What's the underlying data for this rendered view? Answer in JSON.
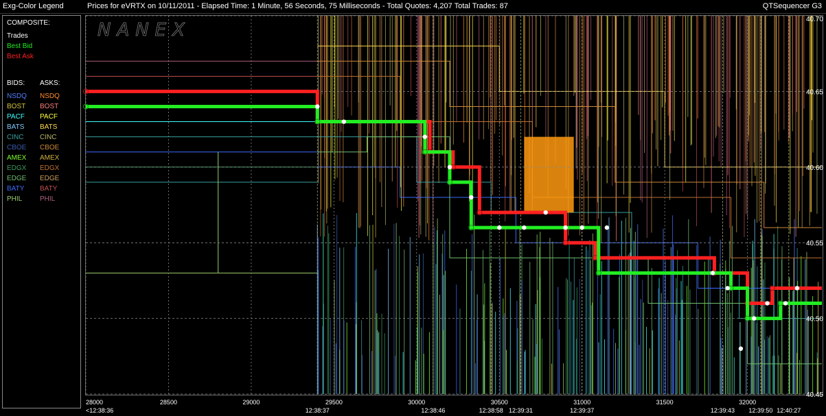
{
  "window": {
    "legend_title": "Exg-Color Legend",
    "chart_title": "Prices for  eVRTX  on  10/11/2011  -  Elapsed Time: 1 Minute, 56 Seconds, 75 Milliseconds  -  Total Quotes: 4,207  Total Trades: 87",
    "app_name": "QTSequencer G3"
  },
  "watermark": "NANEX",
  "legend": {
    "composite_header": "COMPOSITE:",
    "composite": [
      {
        "label": "Trades",
        "color": "#ffffff"
      },
      {
        "label": "Best Bid",
        "color": "#22ee22"
      },
      {
        "label": "Best Ask",
        "color": "#ff2020"
      }
    ],
    "bids_header": "BIDS:",
    "asks_header": "ASKS:",
    "exchanges": [
      {
        "bid": "NSDQ",
        "ask": "NSDQ",
        "bid_color": "#4f7fff",
        "ask_color": "#ff8c30"
      },
      {
        "bid": "BOST",
        "ask": "BOST",
        "bid_color": "#d6c63c",
        "ask_color": "#ff7f7f"
      },
      {
        "bid": "PACF",
        "ask": "PACF",
        "bid_color": "#40ffff",
        "ask_color": "#ffff40"
      },
      {
        "bid": "BATS",
        "ask": "BATS",
        "bid_color": "#7fc8ff",
        "ask_color": "#ffd850"
      },
      {
        "bid": "CINC",
        "ask": "CINC",
        "bid_color": "#3aa0a0",
        "ask_color": "#b7b76a"
      },
      {
        "bid": "CBOE",
        "ask": "CBOE",
        "bid_color": "#3c5cb0",
        "ask_color": "#d08a3a"
      },
      {
        "bid": "AMEX",
        "ask": "AMEX",
        "bid_color": "#7fff30",
        "ask_color": "#d0b040"
      },
      {
        "bid": "EDGX",
        "ask": "EDGX",
        "bid_color": "#3c9c5c",
        "ask_color": "#c07030"
      },
      {
        "bid": "EDGE",
        "ask": "EDGE",
        "bid_color": "#6fbf6f",
        "ask_color": "#d0a060"
      },
      {
        "bid": "BATY",
        "ask": "BATY",
        "bid_color": "#3c6cff",
        "ask_color": "#c05050"
      },
      {
        "bid": "PHIL",
        "ask": "PHIL",
        "bid_color": "#9ccf6c",
        "ask_color": "#b06080"
      }
    ]
  },
  "chart_data": {
    "type": "line",
    "xlabel": "",
    "ylabel": "",
    "xlim": [
      28000,
      32450
    ],
    "ylim": [
      40.45,
      40.7
    ],
    "x_ticks": [
      28000,
      28500,
      29000,
      29500,
      30000,
      30500,
      31000,
      31500,
      32000
    ],
    "y_ticks": [
      40.45,
      40.5,
      40.55,
      40.6,
      40.65,
      40.7
    ],
    "y_tick_labels": [
      "40.45",
      "40.50",
      "40.55",
      "40.60",
      "40.65",
      "40.70"
    ],
    "time_labels": [
      {
        "x": 28000,
        "label": "<12:38:36"
      },
      {
        "x": 29400,
        "label": "12:38:37"
      },
      {
        "x": 30100,
        "label": "12:38:46"
      },
      {
        "x": 30450,
        "label": "12:38:58"
      },
      {
        "x": 30630,
        "label": "12:39:31"
      },
      {
        "x": 31000,
        "label": "12:39:37"
      },
      {
        "x": 31850,
        "label": "12:39:43"
      },
      {
        "x": 32080,
        "label": "12:39:50"
      },
      {
        "x": 32250,
        "label": "12:40:27"
      }
    ],
    "grid": true,
    "legend_position": "left panel",
    "series": [
      {
        "name": "Best Ask",
        "color": "#ff2020",
        "points": [
          [
            28000,
            40.65
          ],
          [
            29400,
            40.65
          ],
          [
            29400,
            40.63
          ],
          [
            30080,
            40.63
          ],
          [
            30080,
            40.61
          ],
          [
            30220,
            40.61
          ],
          [
            30220,
            40.6
          ],
          [
            30380,
            40.6
          ],
          [
            30380,
            40.57
          ],
          [
            30900,
            40.57
          ],
          [
            30900,
            40.55
          ],
          [
            31080,
            40.55
          ],
          [
            31080,
            40.54
          ],
          [
            31800,
            40.54
          ],
          [
            31800,
            40.53
          ],
          [
            32000,
            40.53
          ],
          [
            32000,
            40.51
          ],
          [
            32150,
            40.51
          ],
          [
            32150,
            40.52
          ],
          [
            32450,
            40.52
          ]
        ]
      },
      {
        "name": "Best Bid",
        "color": "#22ee22",
        "points": [
          [
            28000,
            40.64
          ],
          [
            29400,
            40.64
          ],
          [
            29400,
            40.63
          ],
          [
            30050,
            40.63
          ],
          [
            30050,
            40.61
          ],
          [
            30200,
            40.61
          ],
          [
            30200,
            40.59
          ],
          [
            30330,
            40.59
          ],
          [
            30330,
            40.56
          ],
          [
            31100,
            40.56
          ],
          [
            31100,
            40.53
          ],
          [
            31900,
            40.53
          ],
          [
            31900,
            40.52
          ],
          [
            32000,
            40.52
          ],
          [
            32000,
            40.5
          ],
          [
            32200,
            40.5
          ],
          [
            32200,
            40.51
          ],
          [
            32450,
            40.51
          ]
        ]
      },
      {
        "name": "Trades",
        "color": "#ffffff",
        "points": [
          [
            29400,
            40.64
          ],
          [
            29560,
            40.63
          ],
          [
            30050,
            40.62
          ],
          [
            30200,
            40.6
          ],
          [
            30330,
            40.58
          ],
          [
            30500,
            40.56
          ],
          [
            30650,
            40.56
          ],
          [
            30780,
            40.57
          ],
          [
            30900,
            40.56
          ],
          [
            31000,
            40.56
          ],
          [
            31150,
            40.56
          ],
          [
            31790,
            40.53
          ],
          [
            31880,
            40.52
          ],
          [
            31960,
            40.48
          ],
          [
            32040,
            40.5
          ],
          [
            32120,
            40.51
          ],
          [
            32230,
            40.51
          ],
          [
            32300,
            40.52
          ]
        ]
      }
    ]
  }
}
